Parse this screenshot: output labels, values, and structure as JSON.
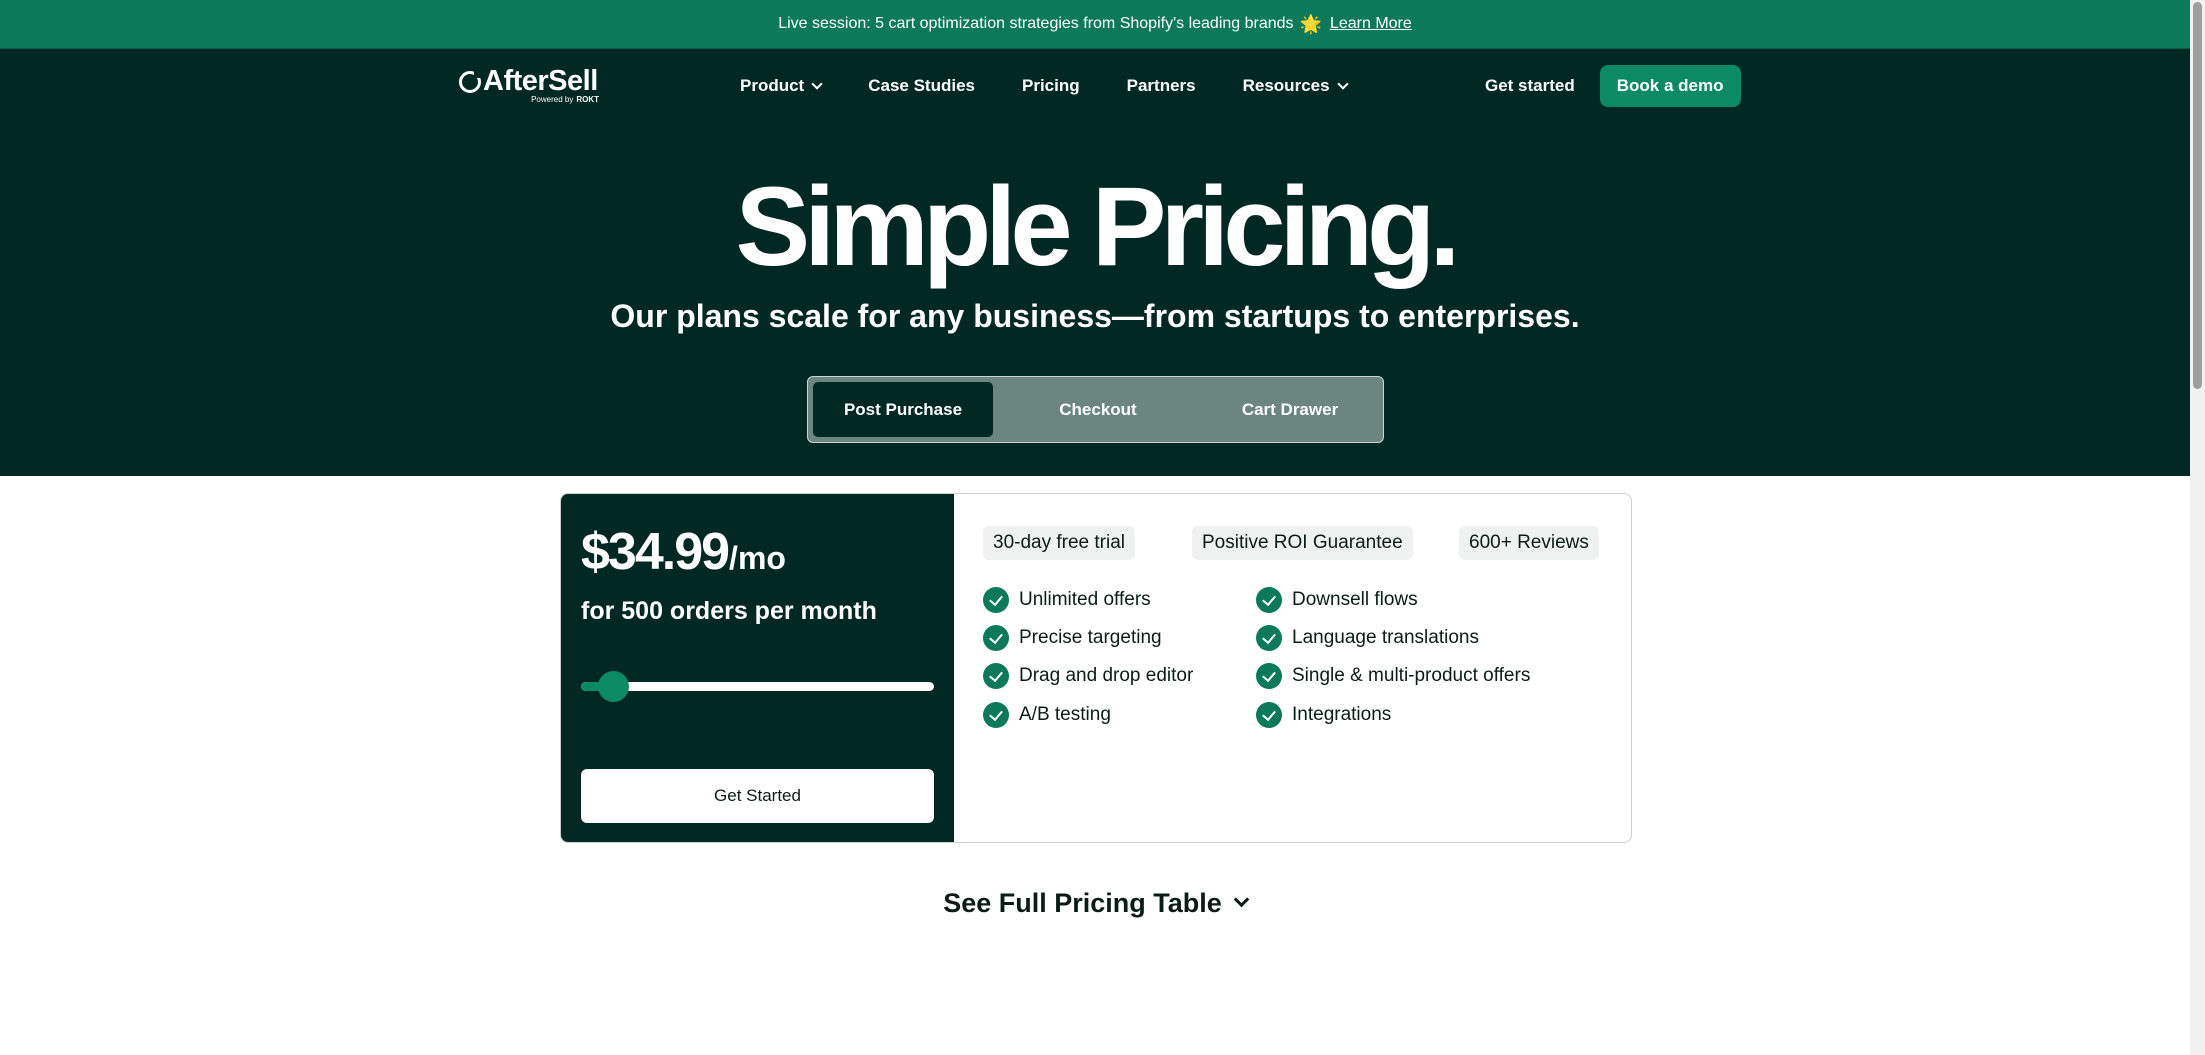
{
  "announcement": {
    "text": "Live session: 5 cart optimization strategies from Shopify's leading brands",
    "star_glyph": "🌟",
    "link_label": "Learn More"
  },
  "brand": {
    "name": "AfterSell",
    "powered_by": "Powered by",
    "partner": "ROKT"
  },
  "nav": {
    "items": [
      {
        "label": "Product",
        "has_dropdown": true
      },
      {
        "label": "Case Studies",
        "has_dropdown": false
      },
      {
        "label": "Pricing",
        "has_dropdown": false
      },
      {
        "label": "Partners",
        "has_dropdown": false
      },
      {
        "label": "Resources",
        "has_dropdown": true
      }
    ],
    "get_started": "Get started",
    "book_demo": "Book a demo"
  },
  "hero": {
    "title": "Simple Pricing.",
    "subtitle": "Our plans scale for any business—from startups to enterprises."
  },
  "tabs": [
    {
      "label": "Post Purchase",
      "active": true
    },
    {
      "label": "Checkout",
      "active": false
    },
    {
      "label": "Cart Drawer",
      "active": false
    }
  ],
  "pricing": {
    "price": "$34.99",
    "period": "/mo",
    "orders_text": "for 500 orders per month",
    "slider_fraction": 0.09,
    "cta": "Get Started",
    "badges": [
      "30-day free trial",
      "Positive ROI Guarantee",
      "600+ Reviews"
    ],
    "features_left": [
      "Unlimited offers",
      "Precise targeting",
      "Drag and drop editor",
      "A/B testing"
    ],
    "features_right": [
      "Downsell flows",
      "Language translations",
      "Single & multi-product offers",
      "Integrations"
    ]
  },
  "full_table": {
    "label": "See Full Pricing Table"
  },
  "colors": {
    "dark_green": "#012822",
    "accent_green": "#0c8a64",
    "banner_green": "#0c7a5a"
  }
}
